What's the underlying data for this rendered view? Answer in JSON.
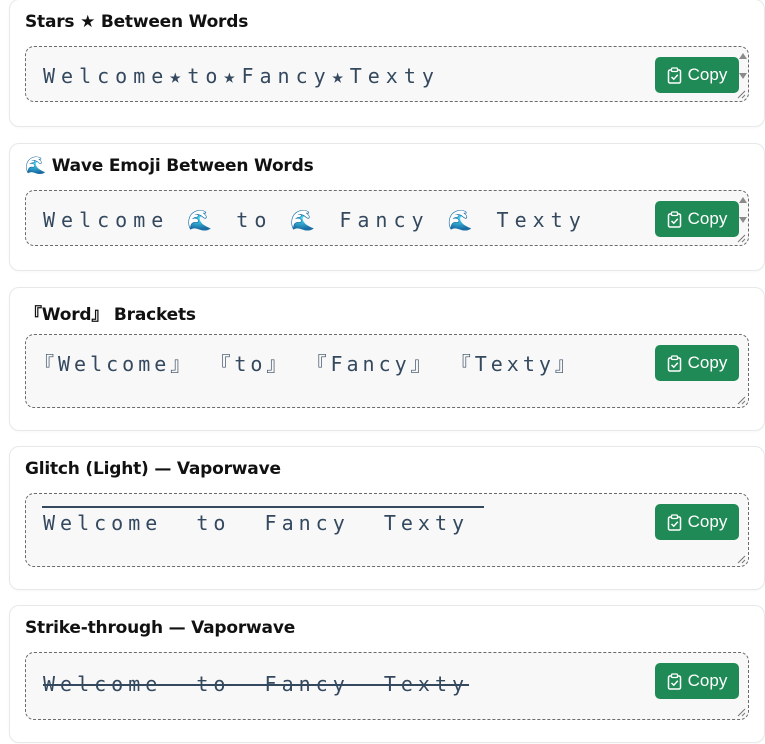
{
  "cards": [
    {
      "title": "Stars ★ Between Words",
      "text": "Welcome★to★Fancy★Texty"
    },
    {
      "title": "Wave Emoji Between Words",
      "text": "Welcome 🌊 to 🌊 Fancy 🌊 Texty",
      "title_icon": "wave-emoji"
    },
    {
      "title": "『Word』 Brackets",
      "text": "『Welcome』 『to』 『Fancy』 『Texty』"
    },
    {
      "title": "Glitch (Light) — Vaporwave",
      "text": "Welcome  to  Fancy  Texty"
    },
    {
      "title": "Strike-through — Vaporwave",
      "text": "Welcome  to  Fancy  Texty"
    }
  ],
  "copy_label": "Copy",
  "colors": {
    "button": "#1f8a55",
    "text": "#34495e"
  },
  "icons": {
    "copy": "clipboard-check-icon",
    "wave": "wave-emoji-icon"
  }
}
